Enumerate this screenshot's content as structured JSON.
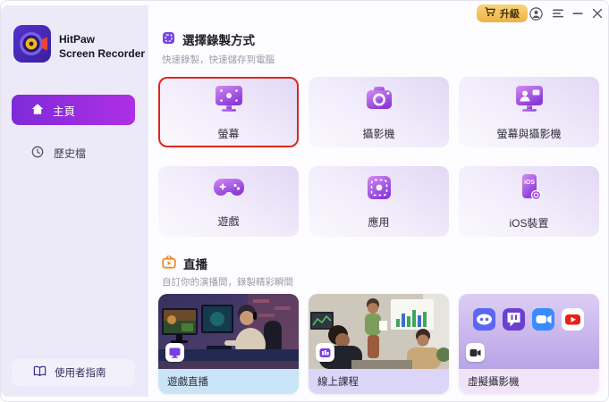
{
  "brand": {
    "line1": "HitPaw",
    "line2": "Screen Recorder"
  },
  "titlebar": {
    "upgrade": "升級"
  },
  "sidebar": {
    "home": "主頁",
    "history": "歷史檔",
    "guide": "使用者指南"
  },
  "record_section": {
    "title": "選擇錄製方式",
    "subtitle": "快速錄製，快速儲存到電腦",
    "cards": [
      {
        "label": "螢幕",
        "icon": "screen-icon",
        "selected": true
      },
      {
        "label": "攝影機",
        "icon": "camera-icon",
        "selected": false
      },
      {
        "label": "螢幕與攝影機",
        "icon": "screen-camera-icon",
        "selected": false
      },
      {
        "label": "遊戲",
        "icon": "gamepad-icon",
        "selected": false
      },
      {
        "label": "應用",
        "icon": "app-window-icon",
        "selected": false
      },
      {
        "label": "iOS裝置",
        "icon": "ios-device-icon",
        "icon_text": "iOS",
        "selected": false
      }
    ]
  },
  "live_section": {
    "title": "直播",
    "subtitle": "自訂你的演播間，錄製精彩瞬間",
    "cards": [
      {
        "label": "遊戲直播",
        "image": "gamer-at-desk",
        "badge_icon": "monitor-icon"
      },
      {
        "label": "線上課程",
        "image": "office-classroom",
        "badge_icon": "whiteboard-icon"
      },
      {
        "label": "虛擬攝影機",
        "image": "app-icons",
        "badge_icon": "camera-icon",
        "app_icons": [
          "discord-icon",
          "twitch-icon",
          "zoom-icon",
          "youtube-icon"
        ]
      }
    ]
  },
  "colors": {
    "accent_purple": "#8B2FD9",
    "selected_border": "#D8291D",
    "upgrade_gold": "#F0BC52",
    "sidebar_bg": "#ECEAF8",
    "live_label_blue": "#C9E4F7",
    "live_label_lavender": "#DBD6F7",
    "live_label_pink": "#F1E4F8"
  }
}
